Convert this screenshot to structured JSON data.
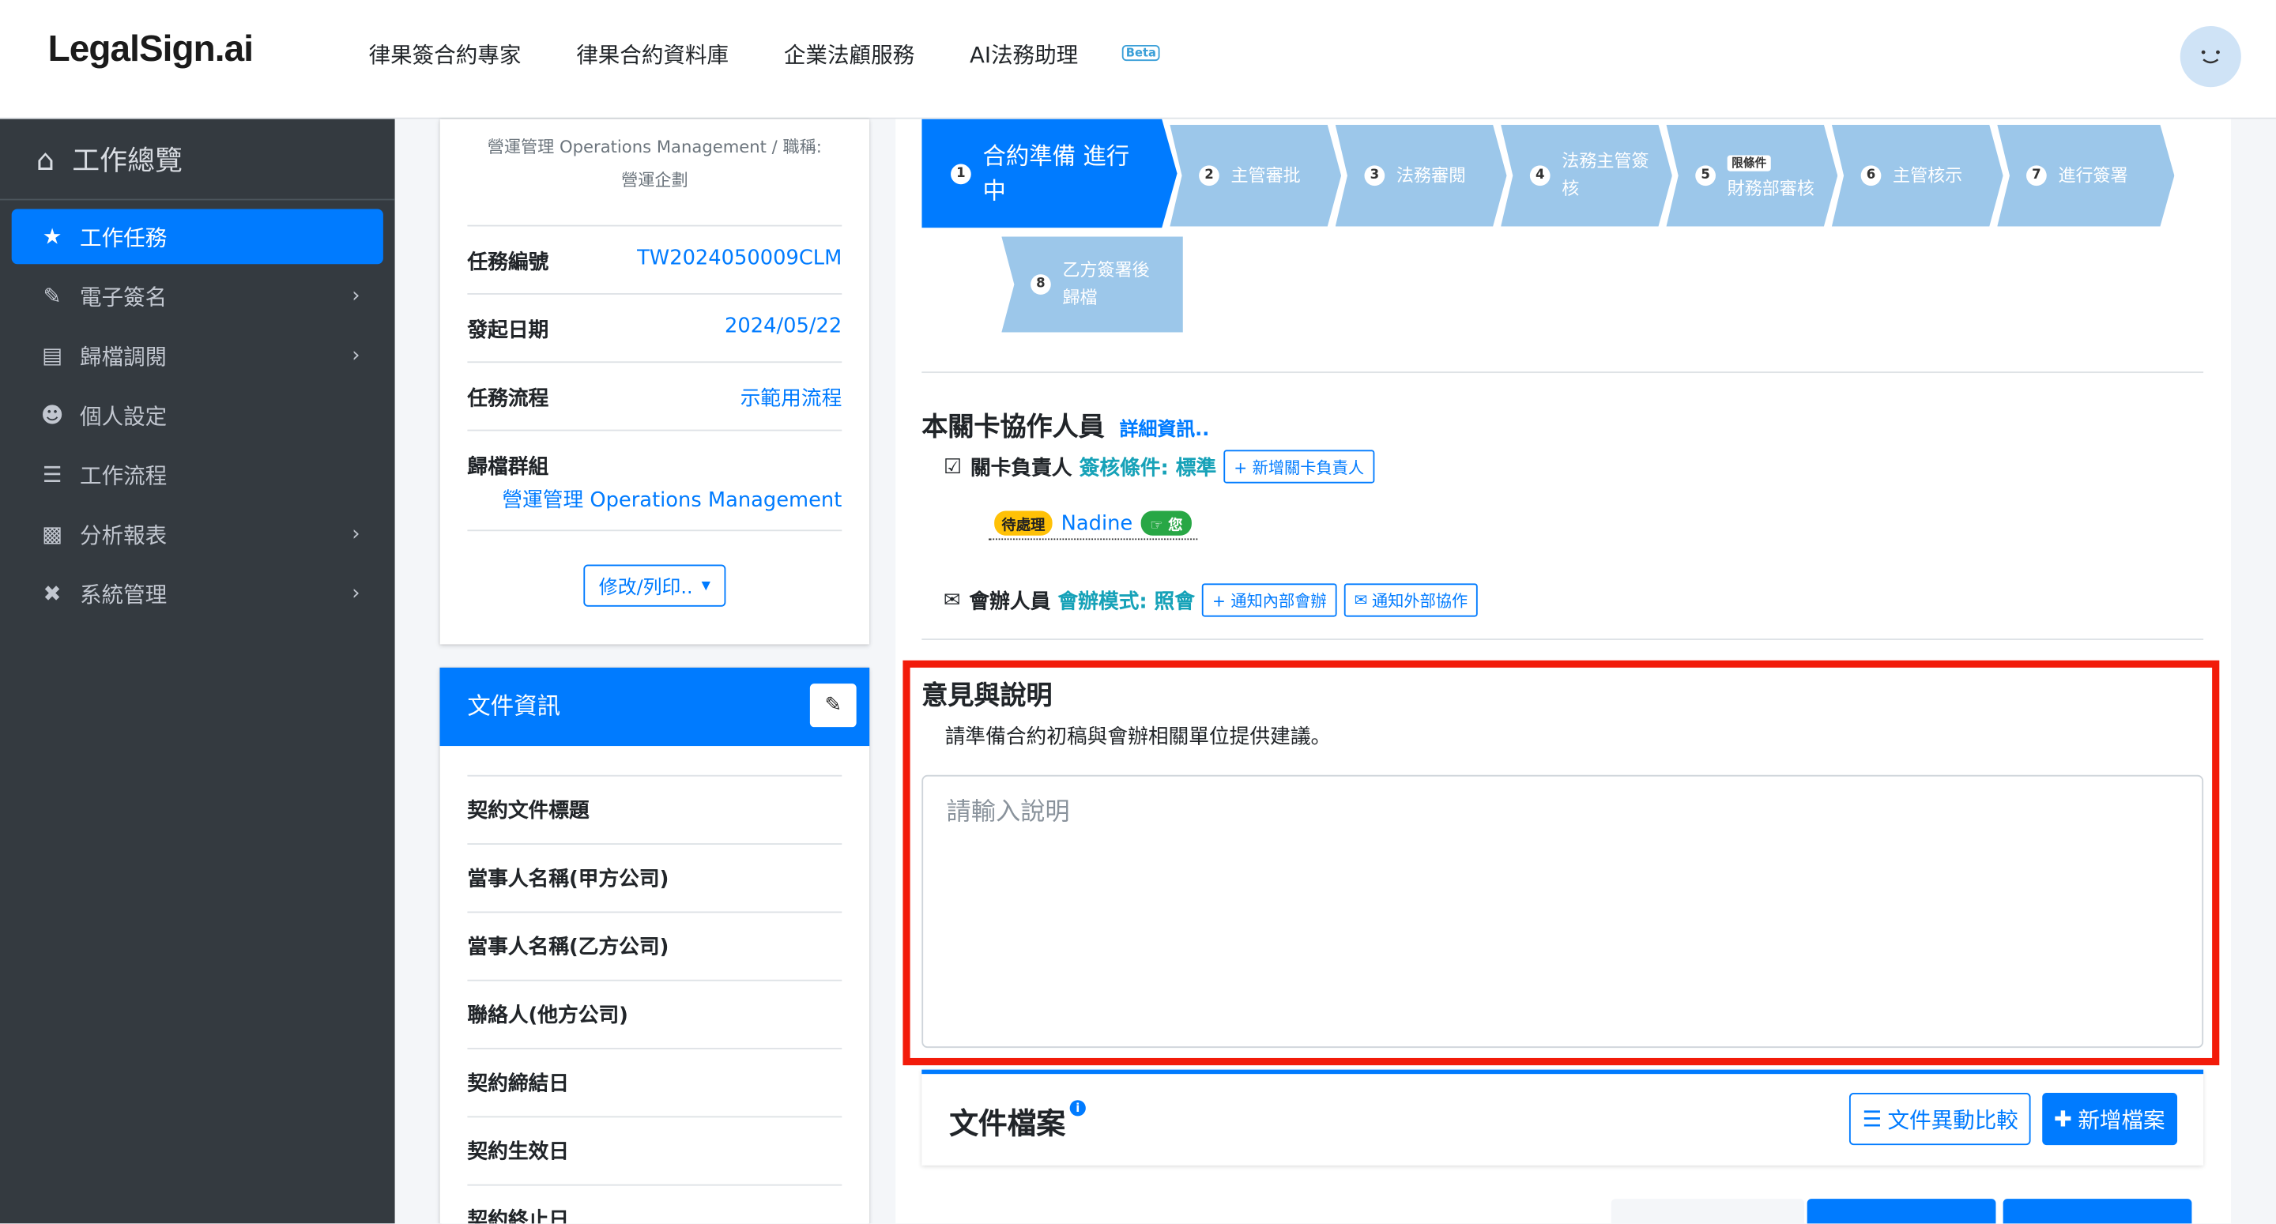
{
  "app": {
    "logo": "LegalSign.ai"
  },
  "topnav": {
    "links": [
      "律果簽合約專家",
      "律果合約資料庫",
      "企業法顧服務",
      "AI法務助理"
    ],
    "beta": "Beta"
  },
  "sidebar": {
    "header": "工作總覽",
    "items": [
      {
        "label": "工作任務",
        "active": true
      },
      {
        "label": "電子簽名"
      },
      {
        "label": "歸檔調閱"
      },
      {
        "label": "個人設定"
      },
      {
        "label": "工作流程"
      },
      {
        "label": "分析報表"
      },
      {
        "label": "系統管理"
      }
    ]
  },
  "task": {
    "org_line1": "營運管理 Operations Management / 職稱:",
    "org_line2": "營運企劃",
    "fields": [
      {
        "key": "任務編號",
        "value": "TW2024050009CLM"
      },
      {
        "key": "發起日期",
        "value": "2024/05/22"
      },
      {
        "key": "任務流程",
        "value": "示範用流程"
      },
      {
        "key": "歸檔群組",
        "value": "營運管理 Operations Management"
      }
    ],
    "dropdown": "修改/列印.."
  },
  "docinfo": {
    "title": "文件資訊",
    "fields": [
      "契約文件標題",
      "當事人名稱(甲方公司)",
      "當事人名稱(乙方公司)",
      "聯絡人(他方公司)",
      "契約締結日",
      "契約生效日",
      "契約終止日"
    ]
  },
  "workflow": {
    "steps": [
      {
        "num": "1",
        "label": "合約準備 進行中"
      },
      {
        "num": "2",
        "label": "主管審批"
      },
      {
        "num": "3",
        "label": "法務審閱"
      },
      {
        "num": "4",
        "label": "法務主管簽核"
      },
      {
        "num": "5",
        "tag": "限條件",
        "label": "財務部審核"
      },
      {
        "num": "6",
        "label": "主管核示"
      },
      {
        "num": "7",
        "label": "進行簽署"
      },
      {
        "num": "8",
        "label": "乙方簽署後歸檔"
      }
    ]
  },
  "collab": {
    "title": "本關卡協作人員",
    "details_link": "詳細資訊..",
    "owner_label": "關卡負責人",
    "owner_condition": "簽核條件: 標準",
    "add_owner": "+ 新增關卡負責人",
    "pending_badge": "待處理",
    "pending_user": "Nadine",
    "you_badge": "您",
    "cosign_label": "會辦人員",
    "cosign_mode": "會辦模式: 照會",
    "notify_internal": "+ 通知內部會辦",
    "notify_external": "通知外部協作"
  },
  "opinion": {
    "title": "意見與說明",
    "description": "請準備合約初稿與會辦相關單位提供建議。",
    "placeholder": "請輸入說明"
  },
  "files": {
    "title": "文件檔案",
    "compare_button": "文件異動比較",
    "add_button": "新增檔案"
  }
}
